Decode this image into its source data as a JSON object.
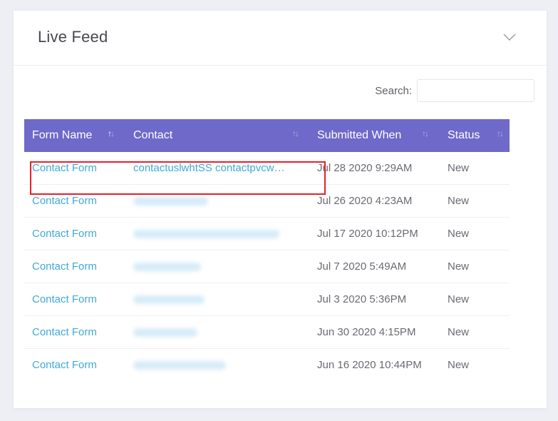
{
  "card": {
    "title": "Live Feed",
    "collapse_icon": "chevron-down-icon"
  },
  "search": {
    "label": "Search:",
    "value": "",
    "placeholder": ""
  },
  "table": {
    "header_color": "#6f69c9",
    "link_color": "#3fa9d6",
    "columns": [
      {
        "label": "Form Name",
        "sort_icon": "sort-arrows-icon"
      },
      {
        "label": "Contact",
        "sort_icon": "sort-arrows-icon"
      },
      {
        "label": "Submitted When",
        "sort_icon": "sort-arrows-icon"
      },
      {
        "label": "Status",
        "sort_icon": "sort-arrows-icon"
      }
    ],
    "rows": [
      {
        "form_name": "Contact Form",
        "contact": "contactuslwhtSS contactpvcw…",
        "contact_blurred": false,
        "submitted": "Jul 28 2020 9:29AM",
        "status": "New"
      },
      {
        "form_name": "Contact Form",
        "contact": "",
        "contact_blurred": true,
        "submitted": "Jul 26 2020 4:23AM",
        "status": "New"
      },
      {
        "form_name": "Contact Form",
        "contact": "",
        "contact_blurred": true,
        "submitted": "Jul 17 2020 10:12PM",
        "status": "New"
      },
      {
        "form_name": "Contact Form",
        "contact": "",
        "contact_blurred": true,
        "submitted": "Jul 7 2020 5:49AM",
        "status": "New"
      },
      {
        "form_name": "Contact Form",
        "contact": "",
        "contact_blurred": true,
        "submitted": "Jul 3 2020 5:36PM",
        "status": "New"
      },
      {
        "form_name": "Contact Form",
        "contact": "",
        "contact_blurred": true,
        "submitted": "Jun 30 2020 4:15PM",
        "status": "New"
      },
      {
        "form_name": "Contact Form",
        "contact": "",
        "contact_blurred": true,
        "submitted": "Jun 16 2020 10:44PM",
        "status": "New"
      }
    ]
  },
  "annotation": {
    "highlight_color": "#e5202a",
    "highlighted_row": 0
  }
}
